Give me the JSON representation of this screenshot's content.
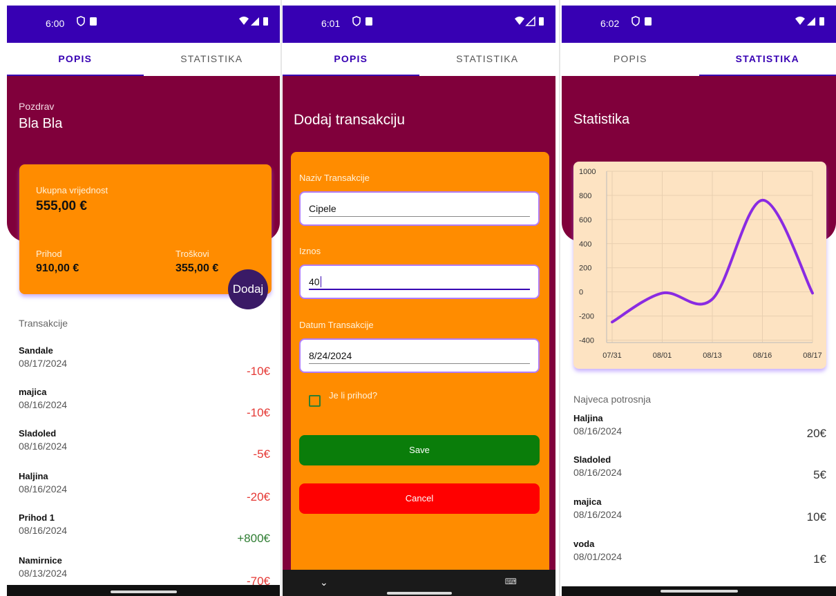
{
  "phones": [
    {
      "time": "6:00",
      "tabs": [
        {
          "label": "POPIS",
          "active": true
        },
        {
          "label": "STATISTIKA",
          "active": false
        }
      ],
      "greeting": "Pozdrav",
      "user_name": "Bla Bla",
      "summary": {
        "total_label": "Ukupna vrijednost",
        "total_value": "555,00 €",
        "income_label": "Prihod",
        "income_value": "910,00 €",
        "expense_label": "Troškovi",
        "expense_value": "355,00 €"
      },
      "add_button": "Dodaj",
      "transactions_title": "Transakcije",
      "transactions": [
        {
          "name": "Sandale",
          "date": "08/17/2024",
          "amount": "-10€",
          "color": "#e53935"
        },
        {
          "name": "majica",
          "date": "08/16/2024",
          "amount": "-10€",
          "color": "#e53935"
        },
        {
          "name": "Sladoled",
          "date": "08/16/2024",
          "amount": "-5€",
          "color": "#e53935"
        },
        {
          "name": "Haljina",
          "date": "08/16/2024",
          "amount": "-20€",
          "color": "#e53935"
        },
        {
          "name": "Prihod 1",
          "date": "08/16/2024",
          "amount": "+800€",
          "color": "#2e7d32"
        },
        {
          "name": "Namirnice",
          "date": "08/13/2024",
          "amount": "-70€",
          "color": "#e53935"
        }
      ]
    },
    {
      "time": "6:01",
      "tabs": [
        {
          "label": "POPIS",
          "active": true
        },
        {
          "label": "STATISTIKA",
          "active": false
        }
      ],
      "form_title": "Dodaj transakciju",
      "fields": {
        "name_label": "Naziv Transakcije",
        "name_value": "Cipele",
        "amount_label": "Iznos",
        "amount_value": "40",
        "date_label": "Datum Transakcije",
        "date_value": "8/24/2024"
      },
      "checkbox_label": "Je li prihod?",
      "checkbox_checked": false,
      "save_label": "Save",
      "cancel_label": "Cancel"
    },
    {
      "time": "6:02",
      "tabs": [
        {
          "label": "POPIS",
          "active": false
        },
        {
          "label": "STATISTIKA",
          "active": true
        }
      ],
      "stat_title": "Statistika",
      "chart_data": {
        "type": "line",
        "x": [
          "07/31",
          "08/01",
          "08/13",
          "08/16",
          "08/17"
        ],
        "series": [
          {
            "values": [
              -250,
              -10,
              -60,
              760,
              -10
            ]
          }
        ],
        "yticks": [
          1000,
          800,
          600,
          400,
          200,
          0,
          -200,
          -400
        ],
        "ylim": [
          -420,
          1000
        ],
        "line_color": "#8a2be2",
        "grid": true
      },
      "top_spend_title": "Najveca potrosnja",
      "top_spend": [
        {
          "name": "Haljina",
          "date": "08/16/2024",
          "amount": "20€"
        },
        {
          "name": "Sladoled",
          "date": "08/16/2024",
          "amount": "5€"
        },
        {
          "name": "majica",
          "date": "08/16/2024",
          "amount": "10€"
        },
        {
          "name": "voda",
          "date": "08/01/2024",
          "amount": "1€"
        }
      ]
    }
  ],
  "colors": {
    "status_bar": "#3700b3",
    "hero": "#80003b",
    "card": "#ff8c00",
    "chart_card": "#fde3c2",
    "save": "#0a7d0a",
    "cancel": "#ff0000"
  }
}
